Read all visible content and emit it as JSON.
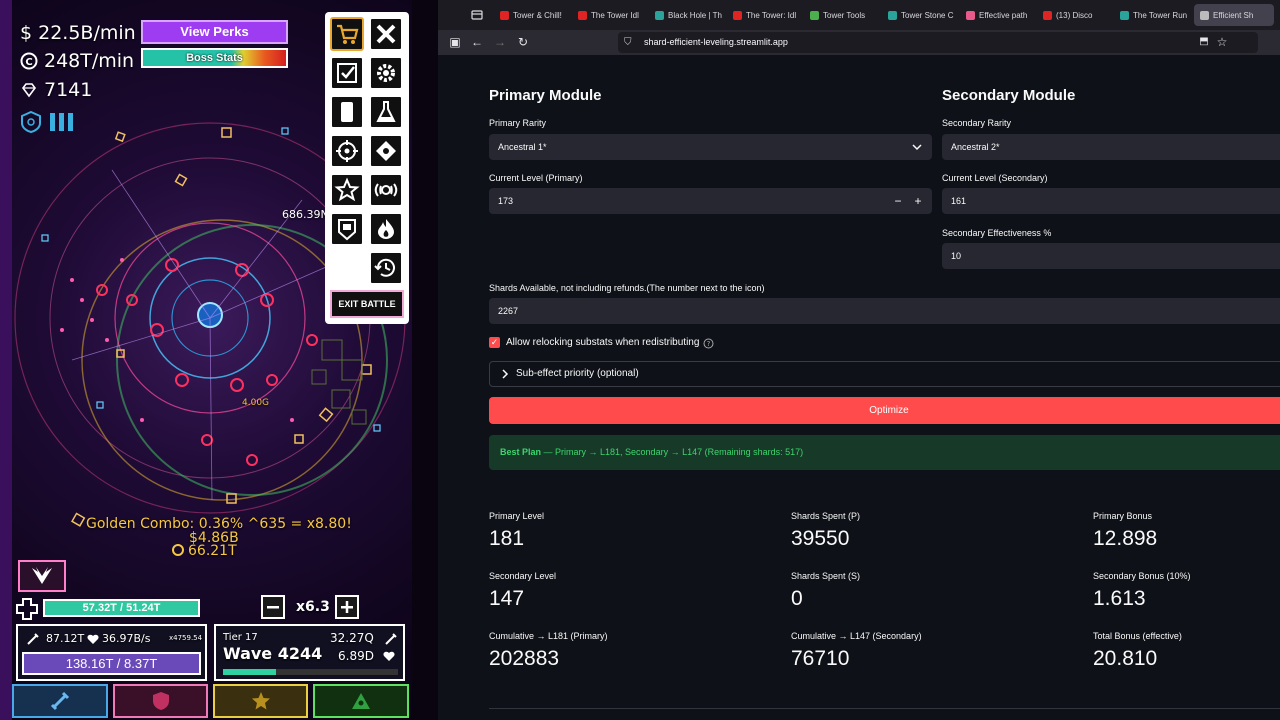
{
  "game": {
    "stats": {
      "cash_rate": "$ 22.5B/min",
      "coin_rate": "248T/min",
      "gems": "7141"
    },
    "view_perks_label": "View Perks",
    "boss_stats_label": "Boss Stats",
    "exit_battle_label": "EXIT BATTLE",
    "floating": {
      "damage_number": "686.39N",
      "mid_number": "4.00G",
      "golden_combo": "Golden Combo: 0.36% ^635 = x8.80!",
      "cash_gain": "$4.86B",
      "coin_gain": "66.21T"
    },
    "health": "57.32T / 51.24T",
    "speed_multiplier": "x6.3",
    "left_panel": {
      "damage": "87.12T",
      "regen": "36.97B/s",
      "coin_mult": "x4759.54",
      "health": "138.16T / 8.37T"
    },
    "right_panel": {
      "tier": "Tier 17",
      "wave": "Wave 4244",
      "enemy_damage": "32.27Q",
      "enemy_health": "6.89D",
      "wave_progress": 0.3
    }
  },
  "browser": {
    "tabs": [
      {
        "label": "Tower & Chill!",
        "color": "#e02424"
      },
      {
        "label": "The Tower Idl",
        "color": "#e02424"
      },
      {
        "label": "Black Hole | Th",
        "color": "#2aa39a"
      },
      {
        "label": "The Tower: Idl",
        "color": "#e02424"
      },
      {
        "label": "Tower Tools",
        "color": "#4cae4c"
      },
      {
        "label": "Tower Stone C",
        "color": "#2aa39a"
      },
      {
        "label": "Effective path",
        "color": "#e85a8a"
      },
      {
        "label": "(13) Disco",
        "color": "#e02424"
      },
      {
        "label": "The Tower Run",
        "color": "#2aa39a"
      },
      {
        "label": "Efficient Sh",
        "color": "#bbbbbb"
      }
    ],
    "url": "shard-efficient-leveling.streamlit.app"
  },
  "app": {
    "primary": {
      "heading": "Primary Module",
      "rarity_label": "Primary Rarity",
      "rarity_value": "Ancestral 1*",
      "level_label": "Current Level (Primary)",
      "level_value": "173"
    },
    "secondary": {
      "heading": "Secondary Module",
      "rarity_label": "Secondary Rarity",
      "rarity_value": "Ancestral 2*",
      "level_label": "Current Level (Secondary)",
      "level_value": "161",
      "effectiveness_label": "Secondary Effectiveness %",
      "effectiveness_value": "10"
    },
    "shards_label": "Shards Available, not including refunds.(The number next to the icon)",
    "shards_value": "2267",
    "relock_label": "Allow relocking substats when redistributing",
    "relock_checked": true,
    "sub_effect_label": "Sub-effect priority (optional)",
    "optimize_label": "Optimize",
    "best_plan_label": "Best Plan",
    "best_plan_text": " — Primary → L181, Secondary → L147 (Remaining shards: 517)",
    "metrics": [
      {
        "label": "Primary Level",
        "value": "181"
      },
      {
        "label": "Shards Spent (P)",
        "value": "39550"
      },
      {
        "label": "Primary Bonus",
        "value": "12.898"
      },
      {
        "label": "Secondary Level",
        "value": "147"
      },
      {
        "label": "Shards Spent (S)",
        "value": "0"
      },
      {
        "label": "Secondary Bonus (10%)",
        "value": "1.613"
      },
      {
        "label": "Cumulative → L181 (Primary)",
        "value": "202883"
      },
      {
        "label": "Cumulative → L147 (Secondary)",
        "value": "76710"
      },
      {
        "label": "Total Bonus (effective)",
        "value": "20.810"
      }
    ]
  }
}
